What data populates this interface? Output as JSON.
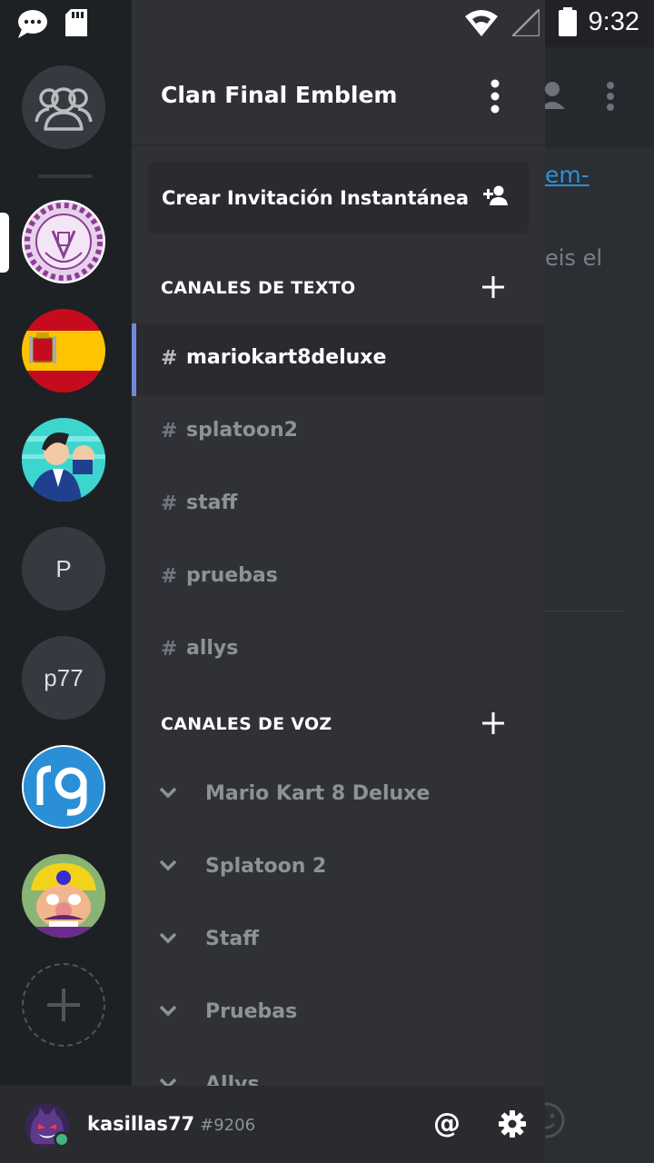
{
  "status_bar": {
    "time": "9:32"
  },
  "background": {
    "link_fragment": "em-",
    "text_fragment": "eis el"
  },
  "rail": {
    "servers": [
      {
        "id": "final-emblem",
        "active": true
      },
      {
        "id": "spain-flag"
      },
      {
        "id": "phoenix-wright"
      },
      {
        "id": "p-server",
        "label": "P"
      },
      {
        "id": "p77-server",
        "label": "p77"
      },
      {
        "id": "rg-server",
        "label": "rg"
      },
      {
        "id": "wario-server"
      }
    ]
  },
  "guild": {
    "name": "Clan Final Emblem",
    "invite_label": "Crear Invitación Instantánea"
  },
  "text_category": {
    "label": "CANALES DE TEXTO",
    "channels": [
      {
        "name": "mariokart8deluxe",
        "active": true
      },
      {
        "name": "splatoon2"
      },
      {
        "name": "staff"
      },
      {
        "name": "pruebas"
      },
      {
        "name": "allys"
      }
    ]
  },
  "voice_category": {
    "label": "CANALES DE VOZ",
    "channels": [
      {
        "name": "Mario Kart 8 Deluxe"
      },
      {
        "name": "Splatoon 2"
      },
      {
        "name": "Staff"
      },
      {
        "name": "Pruebas"
      },
      {
        "name": "Allys"
      }
    ]
  },
  "user": {
    "name": "kasillas77",
    "discriminator": "#9206",
    "status": "online"
  },
  "colors": {
    "accent": "#7289da",
    "online": "#43b581",
    "link": "#2f8fd6"
  },
  "icons": [
    "friends-icon",
    "person-add-icon",
    "plus-icon",
    "chevron-down-icon",
    "at-icon",
    "gear-icon",
    "more-vertical-icon"
  ]
}
